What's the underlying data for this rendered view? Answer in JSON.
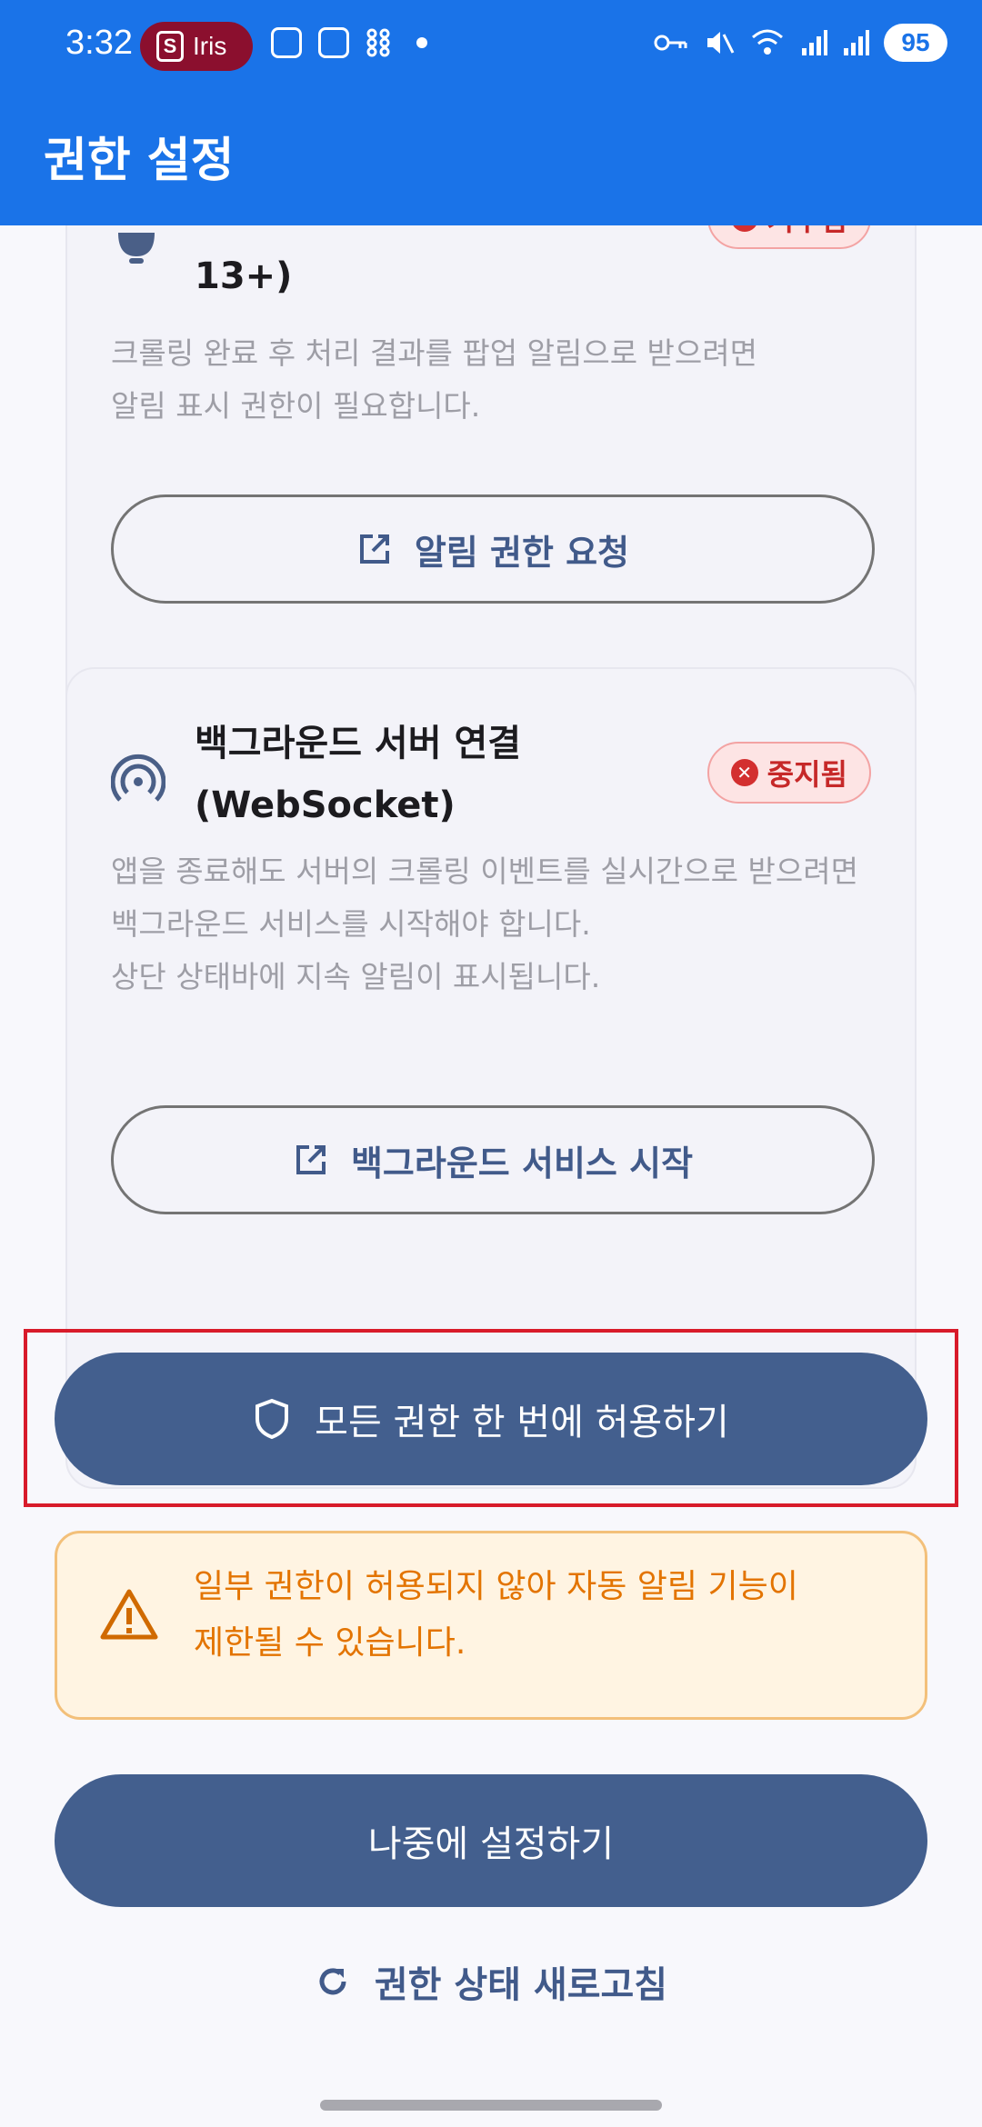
{
  "status_bar": {
    "time": "3:32",
    "chip_label": "Iris",
    "chip_logo": "S",
    "battery": "95"
  },
  "app_bar": {
    "title": "권한 설정"
  },
  "card_notification": {
    "title_fragment": "13+)",
    "badge": "거부됨",
    "description": "크롤링 완료 후 처리 결과를 팝업 알림으로 받으려면\n알림 표시 권한이 필요합니다.",
    "button_label": "알림 권한 요청"
  },
  "card_background": {
    "title_line1": "백그라운드 서버 연결",
    "title_line2": "(WebSocket)",
    "badge": "중지됨",
    "description": "앱을 종료해도 서버의 크롤링 이벤트를 실시간으로 받으려면\n백그라운드 서비스를 시작해야 합니다.\n상단 상태바에 지속 알림이 표시됩니다.",
    "button_label": "백그라운드 서비스 시작"
  },
  "allow_all_button": {
    "label": "모든 권한 한 번에 허용하기"
  },
  "warning": {
    "text": "일부 권한이 허용되지 않아 자동 알림 기능이\n제한될 수 있습니다."
  },
  "later_button": {
    "label": "나중에 설정하기"
  },
  "refresh": {
    "label": "권한 상태 새로고침"
  },
  "colors": {
    "app_bar": "#1a73e8",
    "primary": "#435f8e",
    "danger": "#d32f2f",
    "warning": "#e37400",
    "highlight": "#d81b2a"
  }
}
